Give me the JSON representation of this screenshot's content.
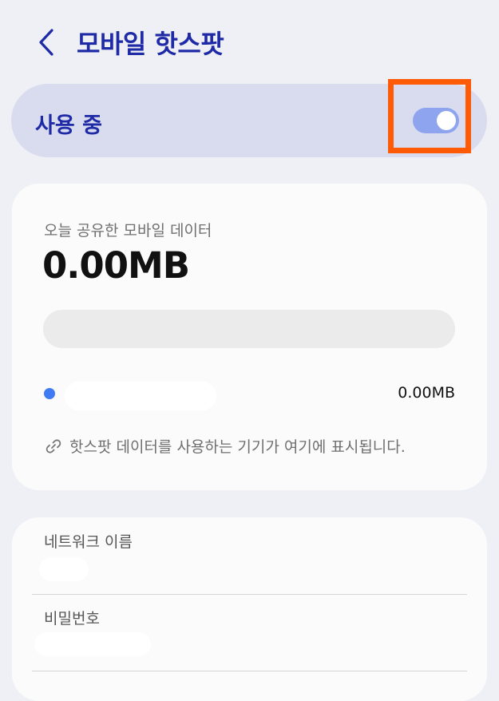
{
  "header": {
    "title": "모바일 핫스팟",
    "back_icon": "chevron-left-icon"
  },
  "hotspot_switch": {
    "label": "사용 중",
    "state": "on",
    "track_color": "#8fa4ef",
    "highlight_color": "#ff5a05"
  },
  "usage": {
    "label": "오늘 공유한 모바일 데이터",
    "total": "0.00MB",
    "fill_fraction": 0,
    "device": {
      "usage": "0.00MB",
      "dot_color": "#3f7cf4"
    },
    "hint": "핫스팟 데이터를 사용하는 기기가 여기에 표시됩니다.",
    "hint_icon": "link-icon"
  },
  "network": {
    "name_label": "네트워크 이름",
    "password_label": "비밀번호"
  },
  "colors": {
    "accent": "#1f2aa6",
    "background": "#eff0f5",
    "card": "#fbfbfb"
  }
}
